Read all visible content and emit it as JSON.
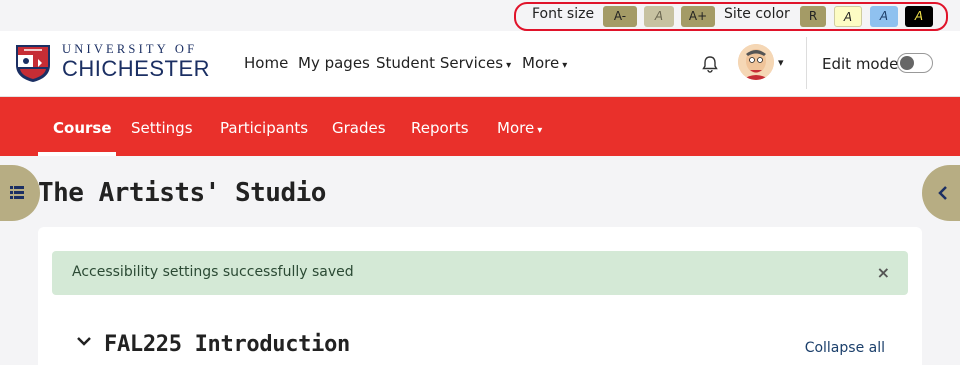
{
  "accessibility": {
    "font_size_label": "Font size",
    "font_decrease": "A-",
    "font_reset": "A",
    "font_increase": "A+",
    "site_color_label": "Site color",
    "color_reset": "R",
    "color_yellow": "A",
    "color_blue": "A",
    "color_black": "A",
    "highlight_color": "#e0132a"
  },
  "header": {
    "logo_line1": "UNIVERSITY OF",
    "logo_line2": "CHICHESTER",
    "nav": {
      "home": "Home",
      "my_pages": "My pages",
      "student_services": "Student Services",
      "more": "More"
    },
    "edit_mode_label": "Edit mode",
    "edit_mode_on": false
  },
  "course_nav": {
    "items": [
      "Course",
      "Settings",
      "Participants",
      "Grades",
      "Reports",
      "More"
    ],
    "active": "Course",
    "bg_color": "#e9302b"
  },
  "page": {
    "title": "The Artists' Studio",
    "alert": {
      "message": "Accessibility settings successfully saved",
      "close": "×"
    },
    "section_title": "FAL225 Introduction",
    "collapse_all": "Collapse all"
  }
}
